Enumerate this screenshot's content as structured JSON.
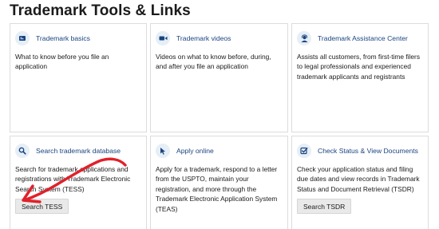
{
  "page": {
    "title": "Trademark Tools & Links"
  },
  "cards": [
    {
      "icon": "document-icon",
      "title": "Trademark basics",
      "description": "What to know before you file an application"
    },
    {
      "icon": "video-camera-icon",
      "title": "Trademark videos",
      "description": "Videos on what to know before, during, and after you file an application"
    },
    {
      "icon": "support-person-icon",
      "title": "Trademark Assistance Center",
      "description": "Assists all customers, from first-time filers to legal professionals and experienced trademark applicants and registrants"
    },
    {
      "icon": "search-icon",
      "title": "Search trademark database",
      "description": "Search for trademark applications and registrations with Trademark Electronic Search System (TESS)",
      "button": "Search TESS"
    },
    {
      "icon": "mouse-pointer-icon",
      "title": "Apply online",
      "description": "Apply for a trademark, respond to a letter from the USPTO, maintain your registration, and more through the Trademark Electronic Application System (TEAS)"
    },
    {
      "icon": "checkbox-icon",
      "title": "Check Status & View Documents",
      "description": "Check your application status and filing due dates and view records in Trademark Status and Document Retrieval (TSDR)",
      "button": "Search TSDR"
    }
  ],
  "annotation": {
    "arrow_color": "#e0212b"
  },
  "colors": {
    "link": "#1a4480",
    "icon_bg": "#e6eef6",
    "button_bg": "#e9e9e9",
    "card_border": "#dcdcdc"
  }
}
